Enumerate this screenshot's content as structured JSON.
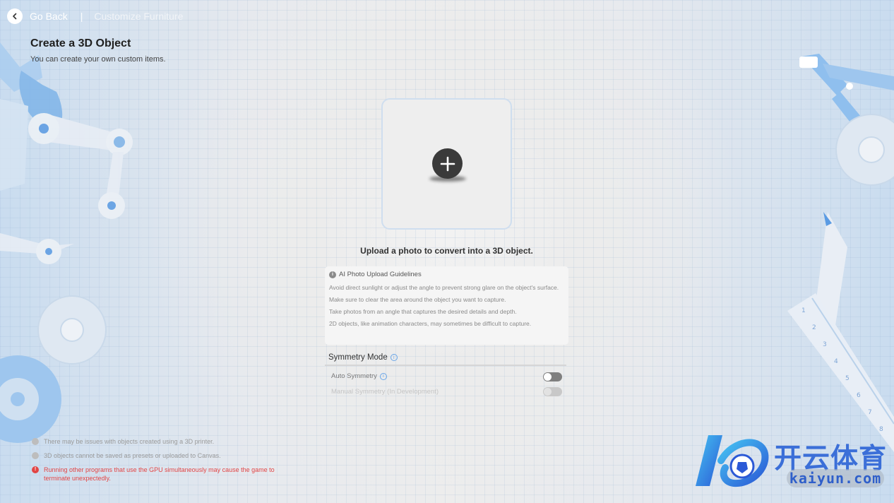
{
  "header": {
    "back_label": "Go Back",
    "separator": "|",
    "breadcrumb": "Customize Furniture"
  },
  "page": {
    "title": "Create a 3D Object",
    "subtitle": "You can create your own custom items."
  },
  "upload": {
    "caption": "Upload a photo to convert into a 3D object."
  },
  "guidelines": {
    "title": "AI Photo Upload Guidelines",
    "items": [
      "Avoid direct sunlight or adjust the angle to prevent strong glare on the object's surface.",
      "Make sure to clear the area around the object you want to capture.",
      "Take photos from an angle that captures the desired details and depth.",
      "2D objects, like animation characters, may sometimes be difficult to capture."
    ]
  },
  "symmetry": {
    "title": "Symmetry Mode",
    "auto_label": "Auto Symmetry",
    "auto_enabled": false,
    "manual_label": "Manual Symmetry (In Development)",
    "manual_enabled": false
  },
  "notes": [
    {
      "text": "There may be issues with objects created using a 3D printer.",
      "level": "info"
    },
    {
      "text": "3D objects cannot be saved as presets or uploaded to Canvas.",
      "level": "info"
    },
    {
      "text": "Running other programs that use the GPU simultaneously may cause the game to terminate unexpectedly.",
      "level": "warning"
    }
  ],
  "watermark": {
    "brand_cn": "开云体育",
    "url": "kaiyun.com"
  },
  "colors": {
    "accent": "#6aa6e8",
    "warning": "#e24545",
    "watermark_blue": "#3b6fd8"
  }
}
